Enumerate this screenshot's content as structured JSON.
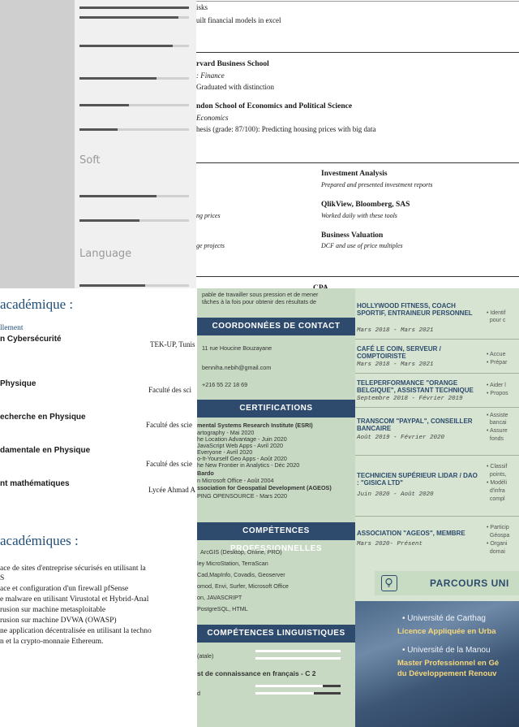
{
  "grey_resume": {
    "soft_title": "Soft",
    "langue_title": "Language"
  },
  "harvard_resume": {
    "line_risks": "isks",
    "line_models": "uilt financial models in excel",
    "school1": "rvard Business School",
    "school1_field": ": Finance",
    "school1_note": "Graduated with distinction",
    "school2": "ndon School of Economics and Political Science",
    "school2_field": " Economics",
    "school2_thesis": "hesis (grade: 87/100): Predicting housing prices with big data",
    "left_note1": "ng prices",
    "left_note2": "ge projects",
    "skills": [
      {
        "name": "Investment Analysis",
        "desc": "Prepared and presented investment reports"
      },
      {
        "name": "QlikView, Bloomberg, SAS",
        "desc": "Worked daily with these tools"
      },
      {
        "name": "Business Valuation",
        "desc": "DCF and use of price multiples"
      }
    ],
    "cpa": "CPA"
  },
  "academic_resume": {
    "heading1": "académique :",
    "sub1": "llement",
    "items": [
      {
        "label": "n Cybersécurité",
        "place": "TEK-UP, Tunis"
      },
      {
        "label": "Physique",
        "place": "Faculté des sci"
      },
      {
        "label": "echerche en Physique",
        "place": "Faculté des scie"
      },
      {
        "label": "damentale en Physique",
        "place": "Faculté des scie"
      },
      {
        "label": "nt mathématiques",
        "place": "Lycée Ahmad A"
      }
    ],
    "heading2": "académiques :",
    "projects": [
      "ace de sites d'entreprise sécurisés en utilisant la",
      "S",
      "ace et configuration d'un firewall pfSense",
      "e malware en utilisant Virustotal et Hybrid-Anal",
      "rusion sur machine metasploitable",
      "rusion sur machine DVWA (OWASP)",
      "ne application décentralisée en utilisant la techno",
      "n et la crypto-monnaie Ethereum."
    ]
  },
  "sage_resume_mid": {
    "intro1": "pable de travailler sous pression et de mener",
    "intro2": "tâches à la fois pour obtenir des résultats de",
    "contact_title": "COORDONNÉES DE CONTACT",
    "address": "11 rue Houcine Bouzayane",
    "email": "benniha.nebih@gmail.com",
    "phone": "+216 55 22 18 69",
    "cert_title": "CERTIFICATIONS",
    "cert_lines": [
      "mental Systems Research Institute (ESRI)",
      "artography - Mai 2020",
      "he Location Advantage - Juin 2020",
      "JavaScript Web Apps - Avril 2020",
      "Everyone - Avril 2020",
      "o-It-Yourself Geo Apps - Août 2020",
      "he New Frontier in Analytics - Déc 2020",
      "Bardo",
      "n Microsoft Office - Août 2004",
      "ssociation for Geospatial Development (AGEOS)",
      "PING OPENSOURCE - Mars 2020"
    ],
    "pro_title": "COMPÉTENCES PROFESSIONNELLES",
    "pro_lines": [
      "ArcGIS (Desktop, Online, PRO)",
      "ley MicroStation, TerraScan",
      "Cad,MapInfo, Covadis, Geoserver",
      "omod, Envi, Surfer, Microsoft Office",
      "on, JAVASCRIPT",
      "PostgreSQL, HTML"
    ],
    "ling_title": "COMPÉTENCES LINGUISTIQUES",
    "lang1": "(atale)",
    "lang2": "st de connaissance en français - C 2",
    "lang3": "d",
    "lang_levels": [
      1.0,
      0.8,
      0.65
    ]
  },
  "sage_resume_right": {
    "jobs": [
      {
        "title": "HOLLYWOOD FITNESS, COACH SPORTIF, ENTRAINEUR PERSONNEL",
        "date": "Mars 2018 - Mars 2021",
        "bullets": [
          "Identif",
          "pour c"
        ]
      },
      {
        "title": "CAFÉ LE COIN, SERVEUR / COMPTOIRISTE",
        "date": "Mars 2018 - Mars 2021",
        "bullets": [
          "Accue",
          "Prépar"
        ]
      },
      {
        "title": "TELEPERFORMANCE \"ORANGE BELGIQUE\", ASSISTANT TECHNIQUE",
        "date": "Septembre 2018 - Février 2019",
        "bullets": [
          "Aider l",
          "Propos"
        ]
      },
      {
        "title": "TRANSCOM \"PAYPAL\", CONSEILLER BANCAIRE",
        "date": "Août 2019 - Février 2020",
        "bullets": [
          "Assiste",
          "bancai",
          "Assure",
          "fonds"
        ]
      },
      {
        "title": "TECHNICIEN SUPÉRIEUR LIDAR / DAO : \"GISICA LTD\"",
        "date": "Juin 2020 - Août 2020",
        "bullets": [
          "Classif",
          "points,",
          "Modéli",
          "d'infra",
          "compl"
        ]
      },
      {
        "title": "ASSOCIATION \"AGEOS\", MEMBRE",
        "date": "Mars 2020- Présent",
        "bullets": [
          "Particip",
          "Géospa",
          "Organi",
          "domai"
        ]
      }
    ],
    "banner_title": "PARCOURS UNI",
    "uni1": "Université de Carthag",
    "deg1": "Licence Appliquée en Urba",
    "uni2": "Université de la Manou",
    "deg2a": "Master Professionnel en Gé",
    "deg2b": "du Développement Renouv"
  }
}
